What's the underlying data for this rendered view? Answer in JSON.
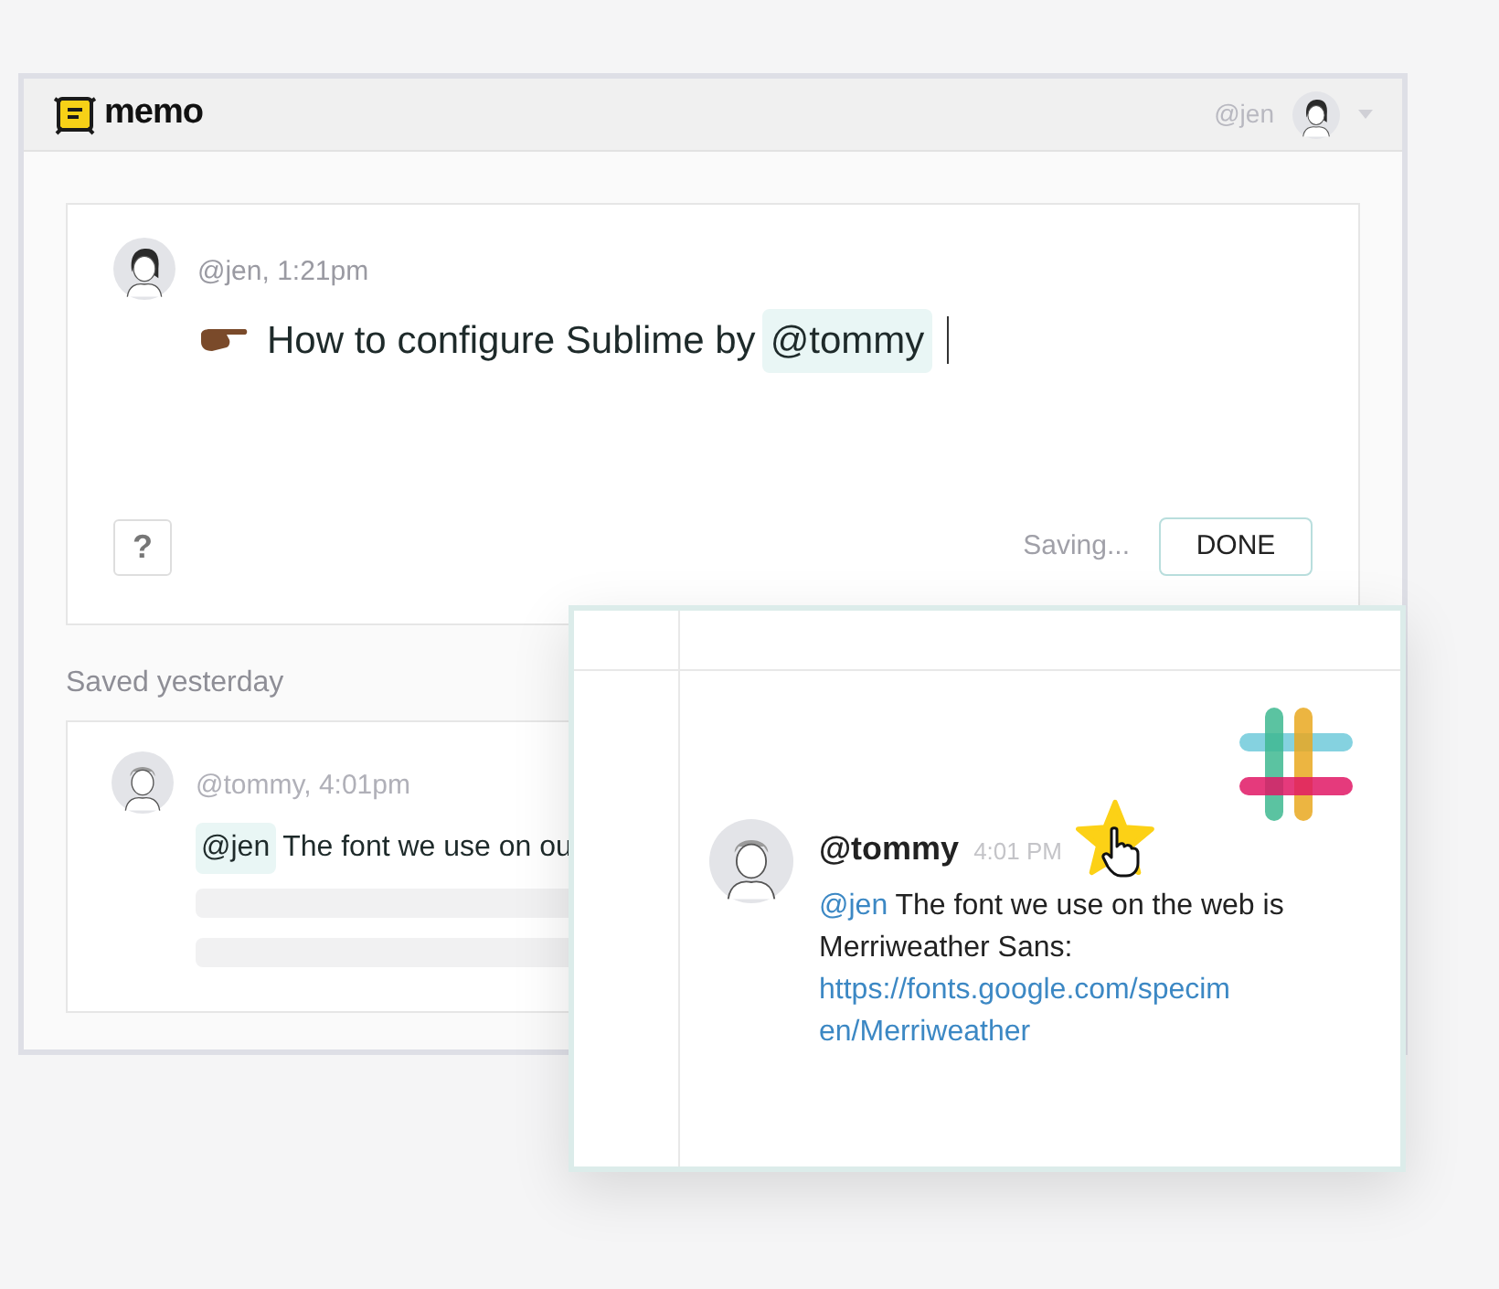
{
  "app": {
    "logo_text": "memo",
    "user": "@jen"
  },
  "editor": {
    "author_meta": "@jen, 1:21pm",
    "title_before": "How to configure Sublime by",
    "mention": "@tommy",
    "help_button": "?",
    "status": "Saving...",
    "done_button": "DONE"
  },
  "history": {
    "heading": "Saved yesterday",
    "entries": [
      {
        "author_meta": "@tommy, 4:01pm",
        "mention": "@jen",
        "text": "The font we use on ou"
      }
    ]
  },
  "slack_message": {
    "author": "@tommy",
    "time": "4:01 PM",
    "starred": true,
    "mention": "@jen",
    "text": "The font we use on the web is Merriweather Sans:",
    "link": "https://fonts.google.com/specimen/Merriweather"
  }
}
